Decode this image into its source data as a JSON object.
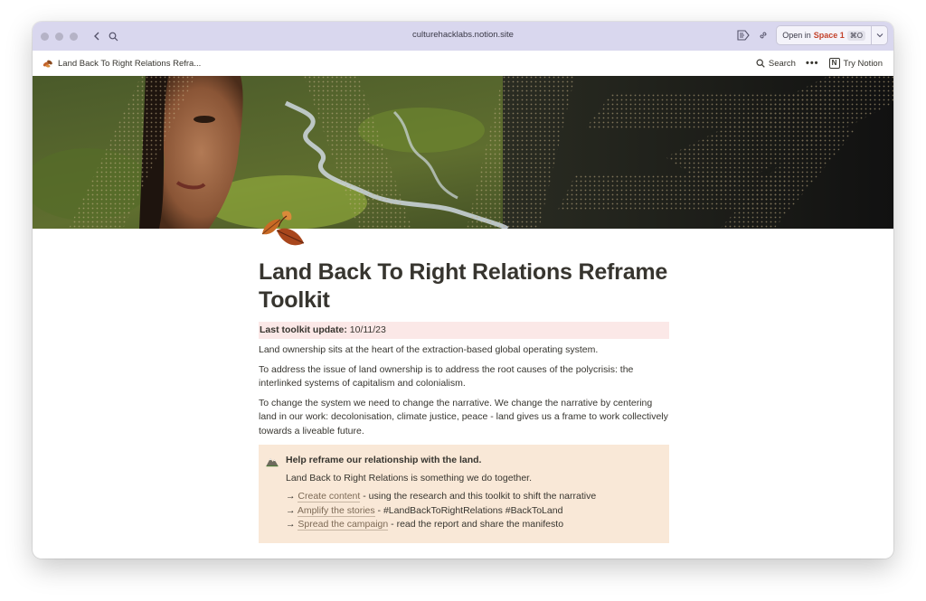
{
  "browser": {
    "url": "culturehacklabs.notion.site",
    "open_in_label": "Open in",
    "space_label": "Space 1",
    "shortcut": "⌘O"
  },
  "topbar": {
    "breadcrumb": "Land Back To Right Relations Refra...",
    "search_label": "Search",
    "more_label": "•••",
    "try_notion_label": "Try Notion",
    "notion_logo_letter": "N"
  },
  "page": {
    "title": "Land Back To Right Relations Reframe Toolkit",
    "update_label": "Last toolkit update:",
    "update_value": "10/11/23",
    "paragraphs": [
      "Land ownership sits at the heart of the extraction-based global operating system.",
      "To address the issue of land ownership is to address the root causes of the polycrisis: the interlinked systems of capitalism and colonialism.",
      "To change the system we need to change the narrative. We change the narrative by centering land in our work: decolonisation, climate justice, peace - land gives us a frame to work collectively towards a liveable future."
    ],
    "callout": {
      "icon": "mountain-icon",
      "heading": "Help reframe our relationship with the land.",
      "subtext": "Land Back to Right Relations is something we do together.",
      "items": [
        {
          "arrow": "→",
          "link": "Create content",
          "rest": " - using the research and this toolkit to shift the narrative"
        },
        {
          "arrow": "→",
          "link": "Amplify the stories",
          "rest": " - #LandBackToRightRelations #BackToLand"
        },
        {
          "arrow": "→",
          "link": "Spread the campaign",
          "rest": " - read the report and share the manifesto"
        }
      ]
    }
  },
  "colors": {
    "update_highlight": "#fbe8e7",
    "callout_bg": "#f9e8d7",
    "link_color": "#7d6a56",
    "toolbar_bg": "#d9d7ee"
  }
}
